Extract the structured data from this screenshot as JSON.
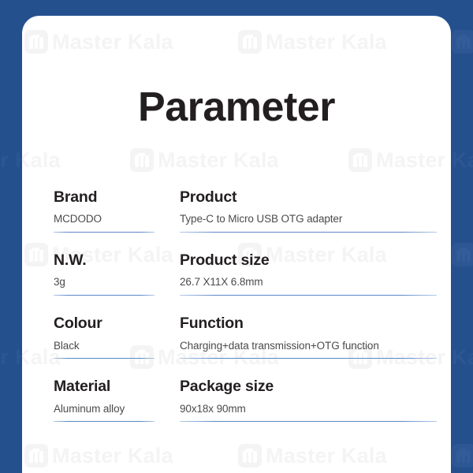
{
  "theme": {
    "frame_blue": "#24508e",
    "card_white": "#ffffff",
    "rule_blue": "#5a87c6",
    "title_color": "#231f20",
    "label_color": "#231f20",
    "value_color": "#4b4b4d",
    "watermark_color": "#f4f4f4"
  },
  "watermark": {
    "text": "Master Kala",
    "logo_icon": "master-kala-logo-icon"
  },
  "header": {
    "title": "Parameter"
  },
  "spec_table": {
    "rows": [
      {
        "left": {
          "label": "Brand",
          "value": "MCDODO"
        },
        "right": {
          "label": "Product",
          "value": "Type-C to Micro USB OTG adapter"
        }
      },
      {
        "left": {
          "label": "N.W.",
          "value": "3g"
        },
        "right": {
          "label": "Product size",
          "value": "26.7 X11X 6.8mm"
        }
      },
      {
        "left": {
          "label": "Colour",
          "value": "Black"
        },
        "right": {
          "label": "Function",
          "value": "Charging+data transmission+OTG function"
        }
      },
      {
        "left": {
          "label": "Material",
          "value": "Aluminum alloy"
        },
        "right": {
          "label": "Package size",
          "value": "90x18x 90mm"
        }
      }
    ]
  }
}
